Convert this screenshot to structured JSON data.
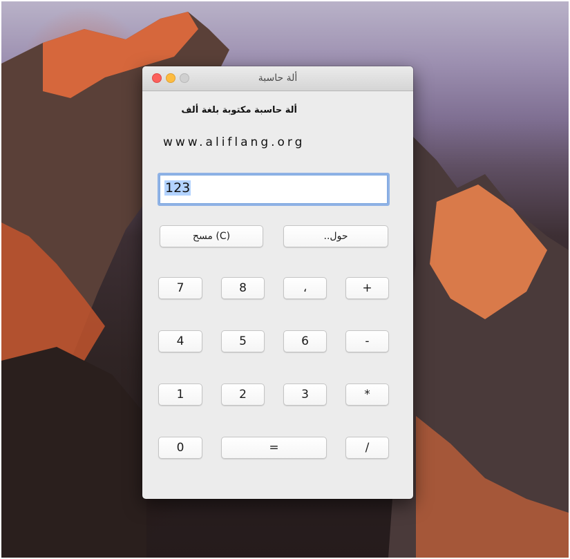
{
  "window": {
    "title": "ألة حاسبة"
  },
  "content": {
    "heading": "ألة حاسبة مكتوبة بلغة ألف",
    "url": "www.aliflang.org",
    "display_value": "123"
  },
  "buttons": {
    "clear": "مسح (C)",
    "about": "..حول",
    "row1": [
      "7",
      "8",
      "،",
      "+"
    ],
    "row2": [
      "4",
      "5",
      "6",
      "-"
    ],
    "row3": [
      "1",
      "2",
      "3",
      "*"
    ],
    "row4_zero": "0",
    "row4_equals": "=",
    "row4_divide": "/"
  },
  "colors": {
    "close": "#fc605c",
    "minimize": "#fdbc40",
    "zoom": "#d0d0d0",
    "focus_ring": "#8fb2e5"
  }
}
